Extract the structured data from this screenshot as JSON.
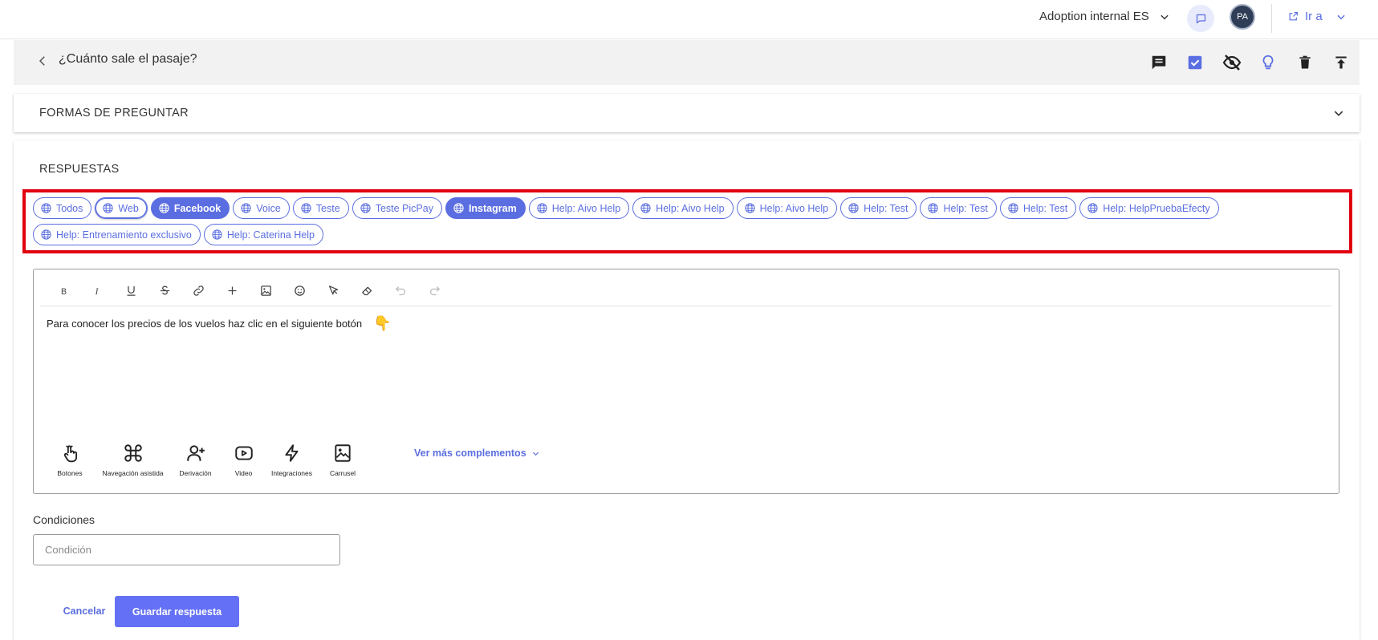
{
  "header": {
    "bot_name": "Adoption internal ES",
    "avatar_initials": "PA",
    "goto_label": "Ir a"
  },
  "intent": {
    "title": "¿Cuánto sale el pasaje?",
    "actions": [
      "comment-icon",
      "checkbox-checked-icon",
      "eye-off-icon",
      "lightbulb-icon",
      "trash-icon",
      "publish-icon"
    ]
  },
  "formas": {
    "label": "FORMAS DE PREGUNTAR"
  },
  "respuestas": {
    "title": "RESPUESTAS",
    "channels": [
      {
        "label": "Todos",
        "active": false
      },
      {
        "label": "Web",
        "active": false
      },
      {
        "label": "Facebook",
        "active": true
      },
      {
        "label": "Voice",
        "active": false
      },
      {
        "label": "Teste",
        "active": false
      },
      {
        "label": "Teste PicPay",
        "active": false
      },
      {
        "label": "Instagram",
        "active": true
      },
      {
        "label": "Help: Aivo Help",
        "active": false
      },
      {
        "label": "Help: Aivo Help",
        "active": false
      },
      {
        "label": "Help: Aivo Help",
        "active": false
      },
      {
        "label": "Help: Test",
        "active": false
      },
      {
        "label": "Help: Test",
        "active": false
      },
      {
        "label": "Help: Test",
        "active": false
      },
      {
        "label": "Help: HelpPruebaEfecty",
        "active": false
      },
      {
        "label": "Help: Entrenamiento exclusivo",
        "active": false
      },
      {
        "label": "Help: Caterina Help",
        "active": false
      }
    ],
    "editor": {
      "tools": [
        "bold-icon",
        "italic-icon",
        "underline-icon",
        "strikethrough-icon",
        "link-icon",
        "plus-icon",
        "image-icon",
        "emoji-icon",
        "cursor-icon",
        "eraser-icon",
        "undo-icon",
        "redo-icon"
      ],
      "text": "Para conocer los precios de los vuelos haz clic en el siguiente botón",
      "emoji": "👇"
    },
    "addons": [
      {
        "label": "Botones",
        "icon": "hand-pointer-icon"
      },
      {
        "label": "Navegación asistida",
        "icon": "command-icon"
      },
      {
        "label": "Derivación",
        "icon": "user-plus-icon"
      },
      {
        "label": "Video",
        "icon": "video-icon"
      },
      {
        "label": "Integraciones",
        "icon": "lightning-icon"
      },
      {
        "label": "Carrusel",
        "icon": "carousel-icon"
      }
    ],
    "more_addons": "Ver más complementos",
    "conditions": {
      "label": "Condiciones",
      "placeholder": "Condición",
      "value": ""
    },
    "cancel_label": "Cancelar",
    "save_label": "Guardar respuesta"
  },
  "colors": {
    "accent": "#5b6ee1",
    "highlight": "#e1000f",
    "save_button": "#6470f5"
  }
}
